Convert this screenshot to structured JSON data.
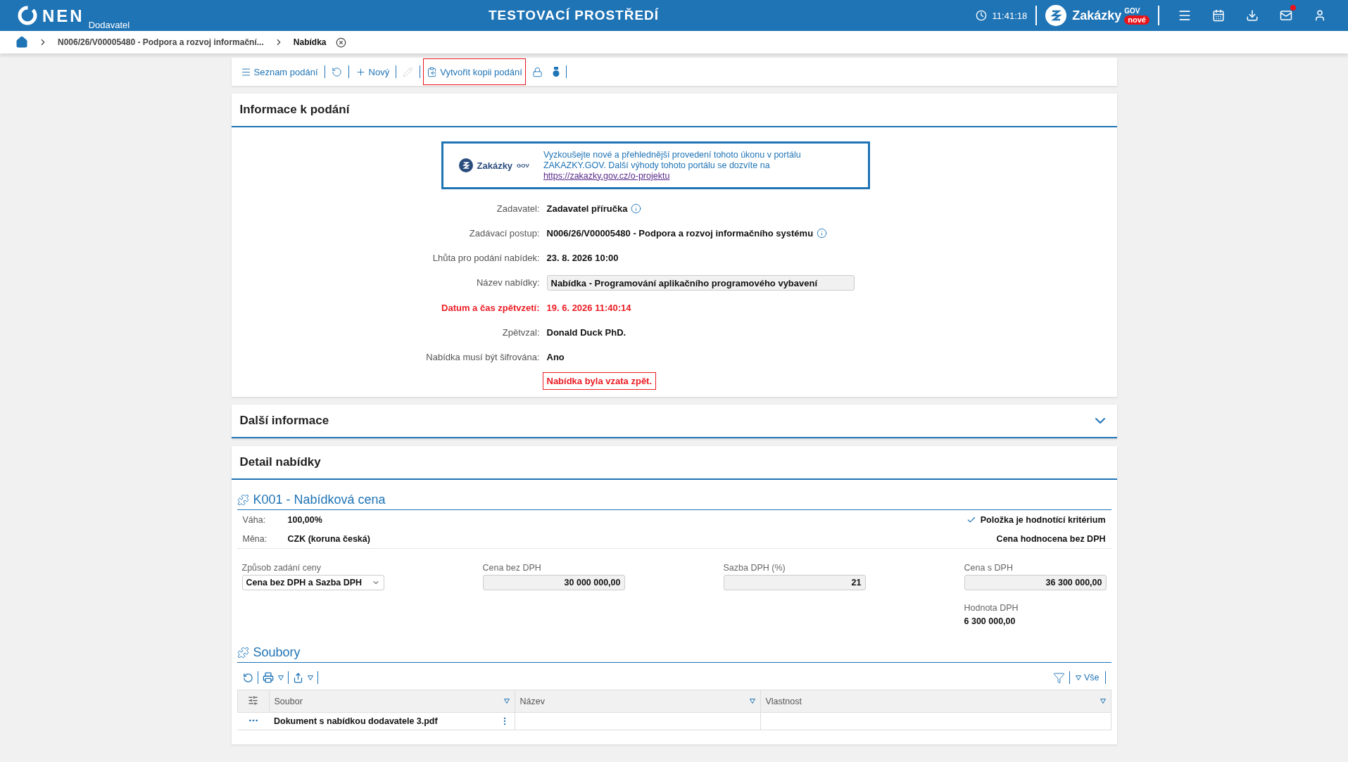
{
  "header": {
    "logo": "NEN",
    "role": "Dodavatel",
    "title": "TESTOVACÍ PROSTŘEDÍ",
    "time": "11:41:18",
    "portal": {
      "name": "Zakázky",
      "sup": "GOV",
      "badge": "nové"
    },
    "mail_unread": true
  },
  "breadcrumb": {
    "items": [
      {
        "label": "N006/26/V00005480 - Podpora a rozvoj informační...",
        "current": false
      },
      {
        "label": "Nabídka",
        "current": true
      }
    ]
  },
  "toolbar": {
    "items": [
      {
        "kind": "list",
        "label": "Seznam podání",
        "disabled": false,
        "highlighted": false
      },
      {
        "kind": "refresh",
        "disabled": false,
        "highlighted": false
      },
      {
        "kind": "new",
        "label": "Nový",
        "disabled": false,
        "highlighted": false
      },
      {
        "kind": "edit",
        "disabled": true,
        "highlighted": false
      },
      {
        "kind": "copy",
        "label": "Vytvořit kopii podání",
        "disabled": false,
        "highlighted": true
      },
      {
        "kind": "lock",
        "disabled": false,
        "highlighted": false
      },
      {
        "kind": "seal",
        "disabled": false,
        "highlighted": false
      }
    ]
  },
  "info": {
    "title": "Informace k podání",
    "banner": {
      "brand": "Zakázky",
      "sup": "GOV",
      "text": "Vyzkoušejte nové a přehlednější provedení tohoto úkonu v portálu ZAKAZKY.GOV. Další výhody tohoto portálu se dozvíte na",
      "link": "https://zakazky.gov.cz/o-projektu"
    },
    "rows": [
      {
        "kind": "info",
        "label": "Zadavatel:",
        "value": "Zadavatel příručka"
      },
      {
        "kind": "info",
        "label": "Zadávací postup:",
        "value": "N006/26/V00005480 - Podpora a rozvoj informačního systému"
      },
      {
        "kind": "text",
        "label": "Lhůta pro podání nabídek:",
        "value": "23. 8. 2026 10:00"
      },
      {
        "kind": "input",
        "label": "Název nabídky:",
        "value": "Nabídka - Programování aplikačního programového vybavení"
      },
      {
        "kind": "alert",
        "label": "Datum a čas zpětvzetí:",
        "value": "19. 6. 2026 11:40:14"
      },
      {
        "kind": "text",
        "label": "Zpětvzal:",
        "value": "Donald Duck PhD."
      },
      {
        "kind": "text",
        "label": "Nabídka musí být šifrována:",
        "value": "Ano"
      }
    ],
    "notice": "Nabídka byla vzata zpět."
  },
  "more_info": {
    "title": "Další informace",
    "expanded": false
  },
  "detail": {
    "title": "Detail nabídky",
    "criterion": {
      "title": "K001 - Nabídková cena",
      "props": [
        {
          "label": "Váha:",
          "value": "100,00%"
        },
        {
          "label": "Měna:",
          "value": "CZK (koruna česká)"
        }
      ],
      "is_criterion": {
        "label": "Položka je hodnotící kritérium",
        "checked": true
      },
      "evaluation": "Cena hodnocena bez DPH",
      "fields": [
        {
          "kind": "select",
          "label": "Způsob zadání ceny",
          "value": "Cena bez DPH a Sazba DPH"
        },
        {
          "kind": "readonly",
          "label": "Cena bez DPH",
          "value": "30 000 000,00"
        },
        {
          "kind": "readonly",
          "label": "Sazba DPH (%)",
          "value": "21"
        },
        {
          "kind": "readonly",
          "label": "Cena s DPH",
          "value": "36 300 000,00"
        }
      ],
      "vat": {
        "label": "Hodnota DPH",
        "value": "6 300 000,00"
      }
    },
    "files": {
      "title": "Soubory",
      "filter": "Vše",
      "columns": [
        "Soubor",
        "Název",
        "Vlastnost"
      ],
      "rows": [
        [
          "Dokument s nabídkou dodavatele 3.pdf",
          "",
          ""
        ]
      ]
    }
  }
}
